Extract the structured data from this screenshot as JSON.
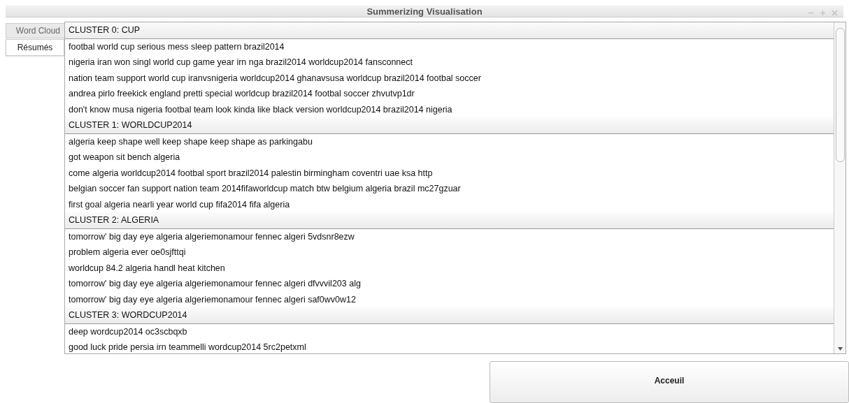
{
  "window": {
    "title": "Summerizing Visualisation"
  },
  "tabs": [
    {
      "label": "Word Cloud",
      "selected": false
    },
    {
      "label": "Résumés",
      "selected": true
    }
  ],
  "clusters": [
    {
      "title": "CLUSTER 0: CUP",
      "items": [
        "footbal world cup serious mess sleep pattern brazil2014",
        "nigeria iran won singl world cup game year irn nga brazil2014 worldcup2014 fansconnect",
        "nation team support world cup iranvsnigeria worldcup2014 ghanavsusa worldcup brazil2014 footbal soccer",
        "andrea pirlo freekick england pretti special worldcup brazil2014 footbal soccer zhvutvp1dr",
        "don't know musa nigeria footbal team look kinda like black version worldcup2014 brazil2014 nigeria"
      ]
    },
    {
      "title": "CLUSTER 1: WORLDCUP2014",
      "items": [
        "algeria keep shape well keep shape keep shape as parkingabu",
        "got weapon sit bench algeria",
        "come algeria worldcup2014 footbal sport brazil2014 palestin birmingham coventri uae ksa http",
        "belgian soccer fan support nation team 2014fifaworldcup match btw belgium algeria brazil mc27gzuar",
        "first goal algeria nearli year world cup fifa2014 fifa algeria"
      ]
    },
    {
      "title": "CLUSTER 2: ALGERIA",
      "items": [
        "tomorrow' big day eye algeria algeriemonamour fennec algeri 5vdsnr8ezw",
        "problem algeria ever oe0sjfttqi",
        "worldcup 84.2 algeria handl heat kitchen",
        "tomorrow' big day eye algeria algeriemonamour fennec algeri dfvvvil203 alg",
        "tomorrow' big day eye algeria algeriemonamour fennec algeri saf0wv0w12"
      ]
    },
    {
      "title": "CLUSTER 3: WORDCUP2014",
      "items": [
        "deep wordcup2014 oc3scbqxb",
        "good luck pride persia irn teammelli wordcup2014 5rc2petxml"
      ]
    }
  ],
  "button": {
    "label": "Acceuil"
  }
}
